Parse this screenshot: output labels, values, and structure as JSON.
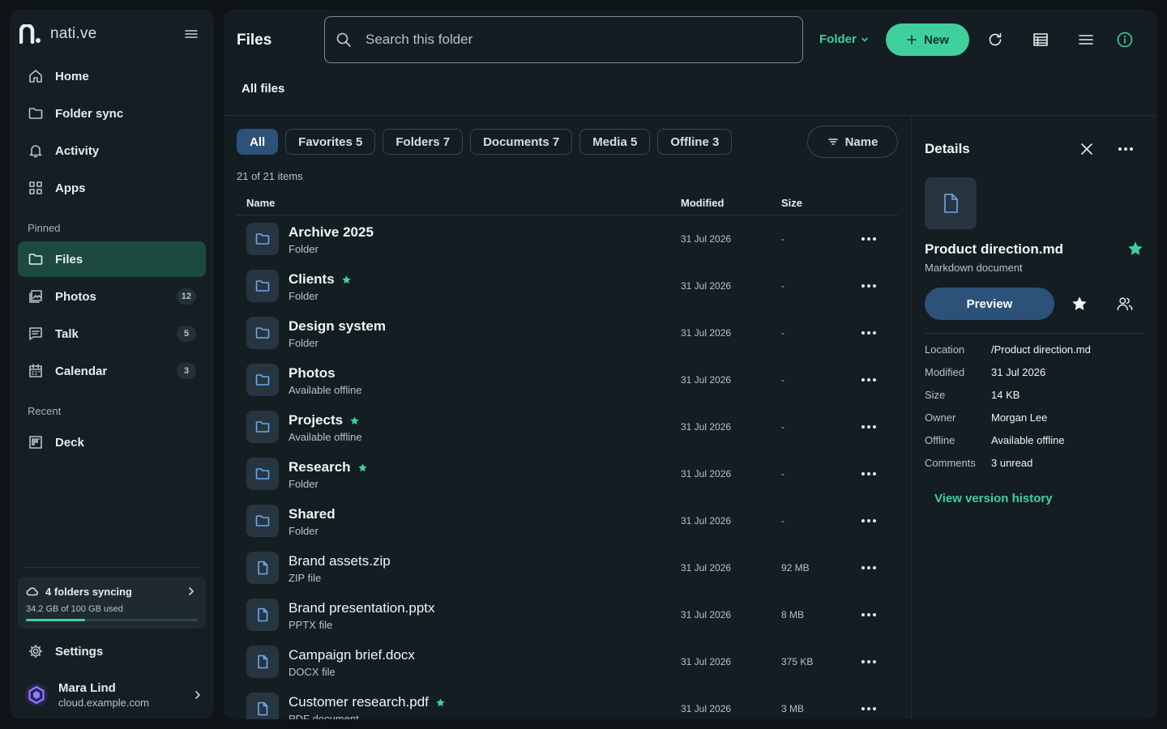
{
  "app": {
    "brand": "nati.ve"
  },
  "sidebar": {
    "main_nav": [
      {
        "label": "Home",
        "icon": "home-icon"
      },
      {
        "label": "Folder sync",
        "icon": "folder-icon"
      },
      {
        "label": "Activity",
        "icon": "bell-icon"
      },
      {
        "label": "Apps",
        "icon": "grid-icon"
      }
    ],
    "pinned_label": "Pinned",
    "pinned": [
      {
        "label": "Files",
        "icon": "folder-icon",
        "active": true,
        "badge": ""
      },
      {
        "label": "Photos",
        "icon": "image-icon",
        "badge": "12"
      },
      {
        "label": "Talk",
        "icon": "chat-icon",
        "badge": "5"
      },
      {
        "label": "Calendar",
        "icon": "calendar-icon",
        "badge": "3"
      }
    ],
    "recent_label": "Recent",
    "recent": [
      {
        "label": "Deck",
        "icon": "deck-icon"
      }
    ],
    "sync": {
      "title": "4 folders syncing",
      "usage": "34.2 GB of 100 GB used",
      "used_fraction": 0.342
    },
    "settings_label": "Settings",
    "user": {
      "name": "Mara Lind",
      "host": "cloud.example.com"
    }
  },
  "header": {
    "title": "Files",
    "search_placeholder": "Search this folder",
    "scope_label": "Folder",
    "new_label": "New"
  },
  "breadcrumb": "All files",
  "filters": [
    {
      "label": "All",
      "active": true
    },
    {
      "label": "Favorites 5"
    },
    {
      "label": "Folders 7"
    },
    {
      "label": "Documents 7"
    },
    {
      "label": "Media 5"
    },
    {
      "label": "Offline 3"
    }
  ],
  "sort_label": "Name",
  "item_count": "21 of 21 items",
  "columns": {
    "name": "Name",
    "modified": "Modified",
    "size": "Size"
  },
  "files": [
    {
      "name": "Archive 2025",
      "sub": "Folder",
      "modified": "31 Jul 2026",
      "size": "-",
      "kind": "folder",
      "starred": false
    },
    {
      "name": "Clients",
      "sub": "Folder",
      "modified": "31 Jul 2026",
      "size": "-",
      "kind": "folder",
      "starred": true
    },
    {
      "name": "Design system",
      "sub": "Folder",
      "modified": "31 Jul 2026",
      "size": "-",
      "kind": "folder",
      "starred": false
    },
    {
      "name": "Photos",
      "sub": "Available offline",
      "modified": "31 Jul 2026",
      "size": "-",
      "kind": "folder",
      "starred": false
    },
    {
      "name": "Projects",
      "sub": "Available offline",
      "modified": "31 Jul 2026",
      "size": "-",
      "kind": "folder",
      "starred": true
    },
    {
      "name": "Research",
      "sub": "Folder",
      "modified": "31 Jul 2026",
      "size": "-",
      "kind": "folder",
      "starred": true
    },
    {
      "name": "Shared",
      "sub": "Folder",
      "modified": "31 Jul 2026",
      "size": "-",
      "kind": "folder",
      "starred": false
    },
    {
      "name": "Brand assets.zip",
      "sub": "ZIP file",
      "modified": "31 Jul 2026",
      "size": "92 MB",
      "kind": "file",
      "starred": false
    },
    {
      "name": "Brand presentation.pptx",
      "sub": "PPTX file",
      "modified": "31 Jul 2026",
      "size": "8 MB",
      "kind": "file",
      "starred": false
    },
    {
      "name": "Campaign brief.docx",
      "sub": "DOCX file",
      "modified": "31 Jul 2026",
      "size": "375 KB",
      "kind": "file",
      "starred": false
    },
    {
      "name": "Customer research.pdf",
      "sub": "PDF document",
      "modified": "31 Jul 2026",
      "size": "3 MB",
      "kind": "file",
      "starred": true
    }
  ],
  "details": {
    "title": "Details",
    "file_name": "Product direction.md",
    "file_type": "Markdown document",
    "starred": true,
    "preview_label": "Preview",
    "properties": [
      {
        "key": "Location",
        "value": "/Product direction.md"
      },
      {
        "key": "Modified",
        "value": "31 Jul 2026"
      },
      {
        "key": "Size",
        "value": "14 KB"
      },
      {
        "key": "Owner",
        "value": "Morgan Lee"
      },
      {
        "key": "Offline",
        "value": "Available offline"
      },
      {
        "key": "Comments",
        "value": "3 unread"
      }
    ],
    "version_link": "View version history"
  },
  "colors": {
    "accent": "#3ecf9c",
    "primary": "#2d527a",
    "file_icon": "#6ea8f0",
    "background": "#0d1316"
  }
}
